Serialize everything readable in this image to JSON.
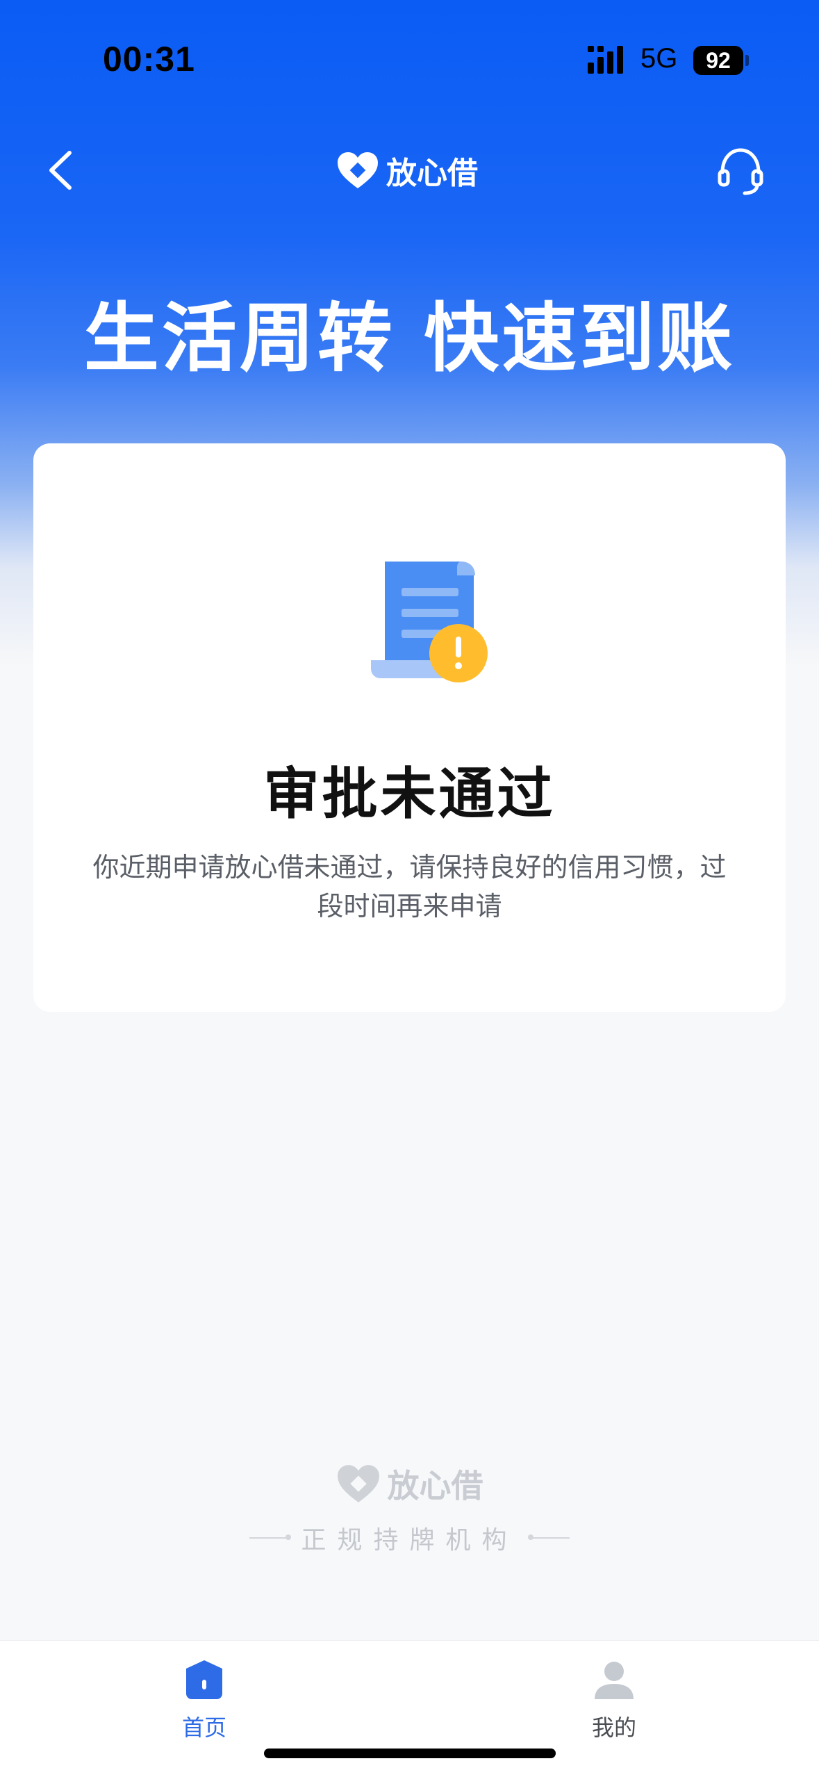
{
  "status_bar": {
    "time": "00:31",
    "network": "5G",
    "battery": "92"
  },
  "nav": {
    "brand_name": "放心借",
    "back_icon": "chevron-left-icon",
    "support_icon": "headset-icon"
  },
  "hero": {
    "slogan": "生活周转 快速到账"
  },
  "result_card": {
    "icon": "document-warning-icon",
    "title": "审批未通过",
    "description": "你近期申请放心借未通过，请保持良好的信用习惯，过段时间再来申请"
  },
  "footer": {
    "brand_name": "放心借",
    "tagline": "正规持牌机构"
  },
  "tab_bar": {
    "tabs": [
      {
        "label": "首页",
        "icon": "home-icon",
        "active": true
      },
      {
        "label": "我的",
        "icon": "user-icon",
        "active": false
      }
    ]
  },
  "colors": {
    "brand_blue": "#0a5cf5",
    "active_tab": "#2e6be6",
    "warning": "#ffbd2e"
  }
}
